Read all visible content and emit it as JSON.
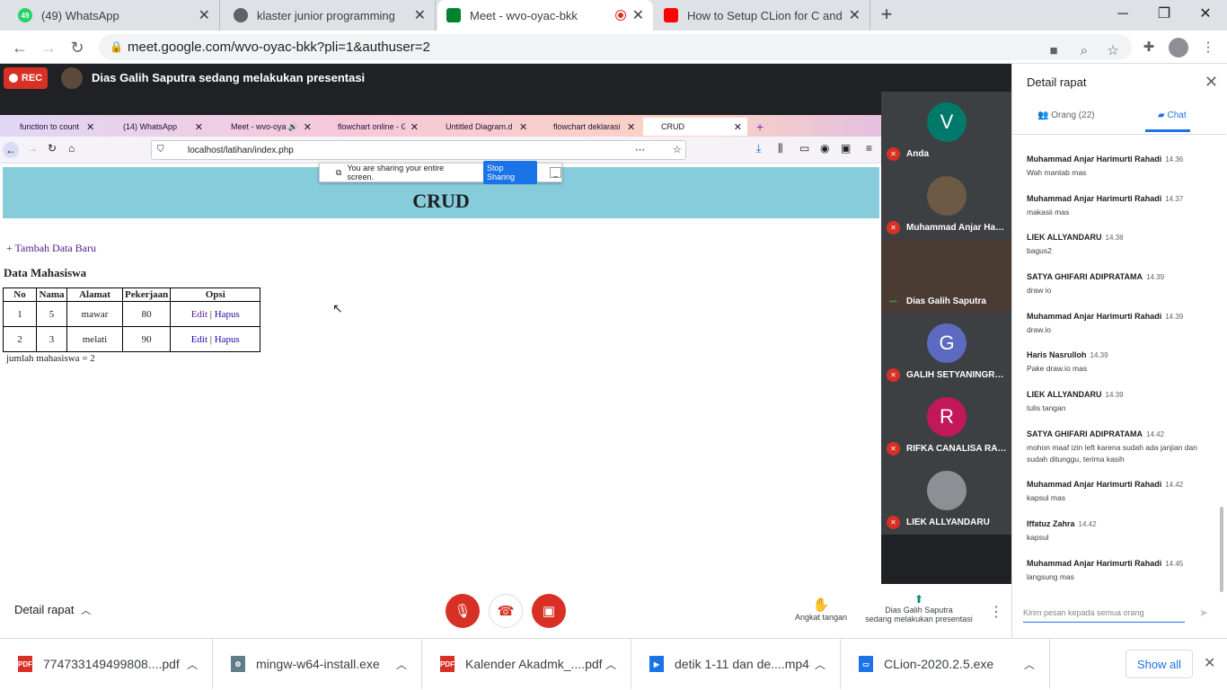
{
  "chrome_tabs": [
    {
      "title": "(49) WhatsApp",
      "icon": "whatsapp-icon",
      "badge": "49",
      "color": "#25d366"
    },
    {
      "title": "klaster junior programming",
      "icon": "globe-icon",
      "badge": "",
      "color": "#5f6368"
    },
    {
      "title": "Meet - wvo-oyac-bkk",
      "icon": "meet-icon",
      "badge": "",
      "color": "#00832d"
    },
    {
      "title": "How to Setup CLion for C and C",
      "icon": "youtube-icon",
      "badge": "",
      "color": "#ff0000"
    }
  ],
  "address": {
    "url": "meet.google.com/wvo-oyac-bkk?pli=1&authuser=2"
  },
  "meet": {
    "rec": "REC",
    "presenter_text": "Dias Galih Saputra sedang melakukan presentasi"
  },
  "firefox": {
    "tabs": [
      "function to count d",
      "(14) WhatsApp",
      "Meet - wvo-oya",
      "flowchart online - G",
      "Untitled Diagram.d",
      "flowchart deklarasi",
      "CRUD"
    ],
    "url": "localhost/latihan/index.php",
    "share_text": "You are sharing your entire screen.",
    "stop_sharing": "Stop Sharing"
  },
  "crud": {
    "title": "CRUD",
    "add_link": "+ Tambah Data Baru",
    "heading": "Data Mahasiswa",
    "columns": [
      "No",
      "Nama",
      "Alamat",
      "Pekerjaan",
      "Opsi"
    ],
    "rows": [
      {
        "no": "1",
        "nama": "5",
        "alamat": "mawar",
        "pekerjaan": "80",
        "edit": "Edit",
        "sep": "|",
        "hapus": "Hapus"
      },
      {
        "no": "2",
        "nama": "3",
        "alamat": "melati",
        "pekerjaan": "90",
        "edit": "Edit",
        "sep": "|",
        "hapus": "Hapus"
      }
    ],
    "count_text": "jumlah mahasiswa = 2"
  },
  "participants": [
    {
      "name": "Anda",
      "initial": "V",
      "color": "#00796b"
    },
    {
      "name": "Muhammad Anjar Harim...",
      "initial": "",
      "color": "#6d5a44"
    },
    {
      "name": "Dias Galih Saputra",
      "initial": "",
      "color": "#4a3b33"
    },
    {
      "name": "GALIH SETYANINGRUM",
      "initial": "G",
      "color": "#5c6bc0"
    },
    {
      "name": "RIFKA CANALISA RAHAYU",
      "initial": "R",
      "color": "#c2185b"
    },
    {
      "name": "LIEK ALLYANDARU",
      "initial": "",
      "color": "#8d8f95"
    }
  ],
  "panel": {
    "title": "Detail rapat",
    "tab_people": "Orang (22)",
    "tab_chat": "Chat",
    "messages": [
      {
        "author": "Muhammad Anjar Harimurti Rahadi",
        "time": "14.36",
        "text": "Wah mantab mas"
      },
      {
        "author": "Muhammad Anjar Harimurti Rahadi",
        "time": "14.37",
        "text": "makasii mas"
      },
      {
        "author": "LIEK ALLYANDARU",
        "time": "14.38",
        "text": "bagus2"
      },
      {
        "author": "SATYA GHIFARI ADIPRATAMA",
        "time": "14.39",
        "text": "draw io"
      },
      {
        "author": "Muhammad Anjar Harimurti Rahadi",
        "time": "14.39",
        "text": "draw.io"
      },
      {
        "author": "Haris Nasrulloh",
        "time": "14.39",
        "text": "Pake draw.io mas"
      },
      {
        "author": "LIEK ALLYANDARU",
        "time": "14.39",
        "text": "tulis tangan"
      },
      {
        "author": "SATYA GHIFARI ADIPRATAMA",
        "time": "14.42",
        "text": "mohon maaf izin left karena sudah ada janjian dan sudah ditunggu, terima kasih"
      },
      {
        "author": "Muhammad Anjar Harimurti Rahadi",
        "time": "14.42",
        "text": "kapsul mas"
      },
      {
        "author": "Iffatuz Zahra",
        "time": "14.42",
        "text": "kapsul"
      },
      {
        "author": "Muhammad Anjar Harimurti Rahadi",
        "time": "14.45",
        "text": "langsung mas"
      }
    ],
    "input_placeholder": "Kirim pesan kepada semua orang"
  },
  "controls": {
    "detail": "Detail rapat",
    "raise_hand": "Angkat tangan",
    "presenting_line1": "Dias Galih Saputra",
    "presenting_line2": "sedang melakukan presentasi"
  },
  "downloads": {
    "items": [
      {
        "name": "774733149499808....pdf",
        "type": "PDF"
      },
      {
        "name": "mingw-w64-install.exe",
        "type": "EXE"
      },
      {
        "name": "Kalender Akadmk_....pdf",
        "type": "PDF"
      },
      {
        "name": "detik 1-11 dan de....mp4",
        "type": "MP4"
      },
      {
        "name": "CLion-2020.2.5.exe",
        "type": "EXE"
      }
    ],
    "show_all": "Show all"
  }
}
